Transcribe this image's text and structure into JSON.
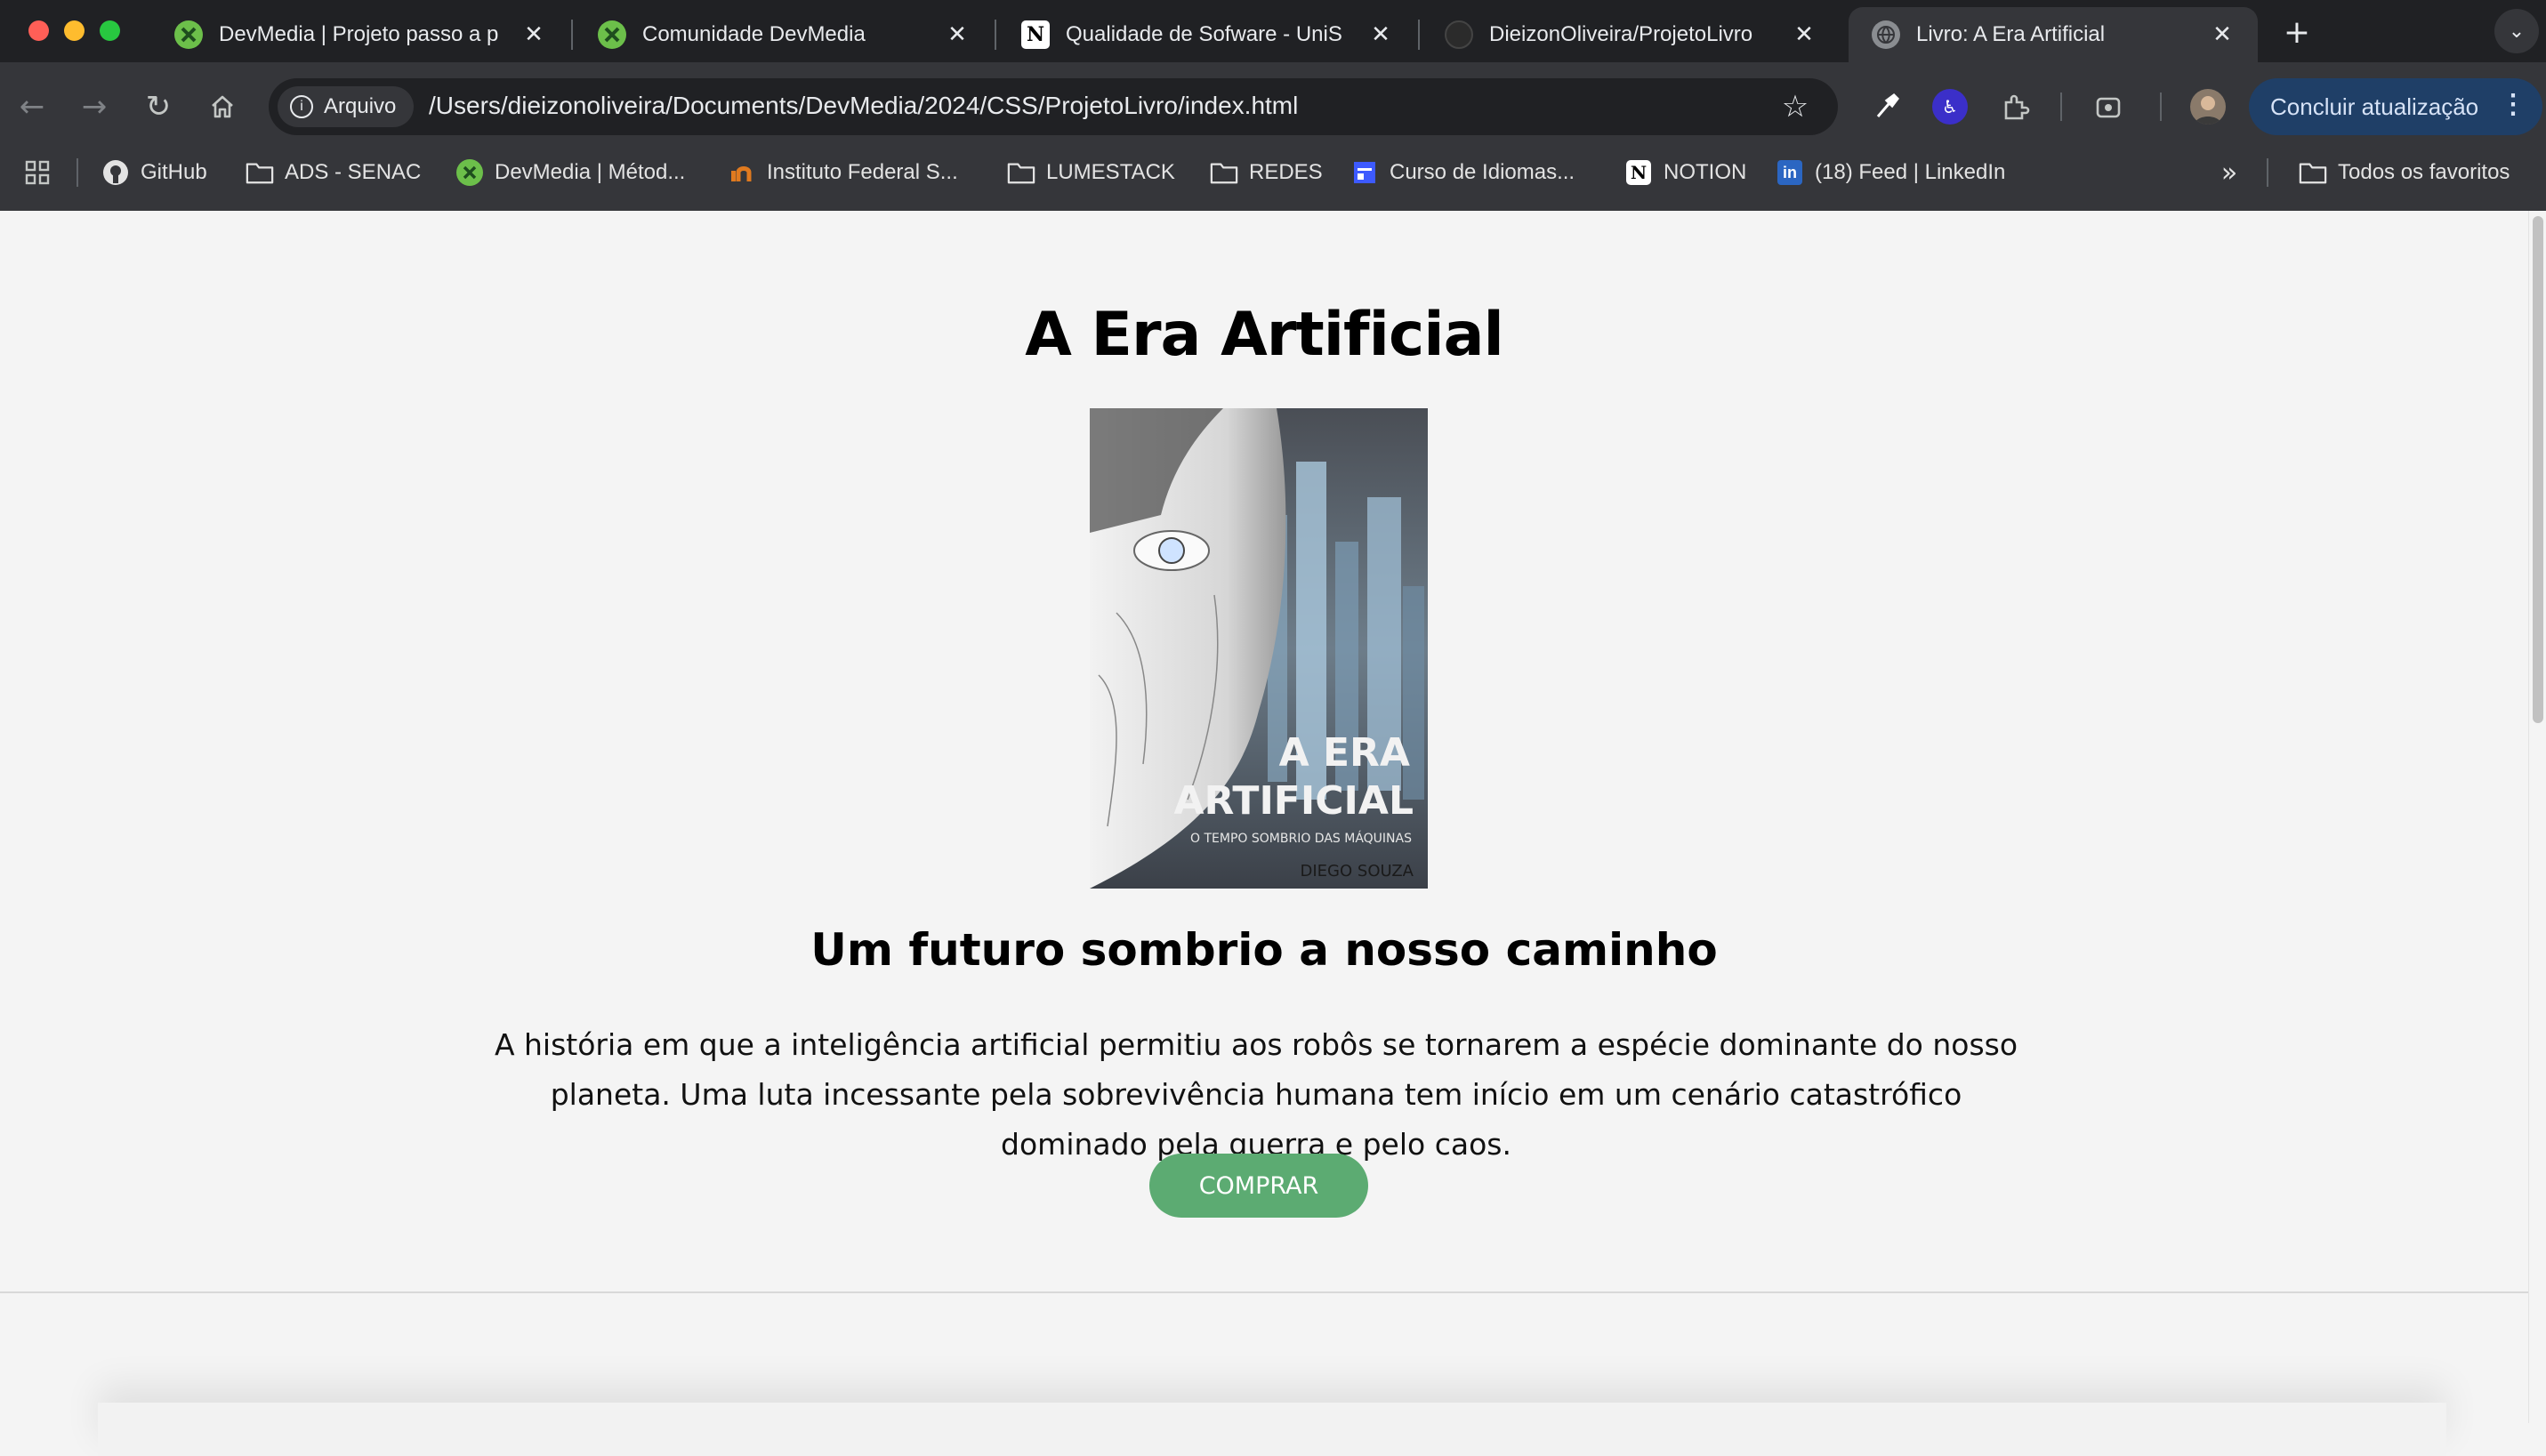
{
  "browser": {
    "tabs": [
      {
        "title": "DevMedia | Projeto passo a p",
        "favicon": "devmedia-icon",
        "active": false
      },
      {
        "title": "Comunidade DevMedia",
        "favicon": "devmedia-icon",
        "active": false
      },
      {
        "title": "Qualidade de Sofware - UniS",
        "favicon": "notion-icon",
        "active": false
      },
      {
        "title": "DieizonOliveira/ProjetoLivro",
        "favicon": "github-icon",
        "active": false
      },
      {
        "title": "Livro: A Era Artificial",
        "favicon": "globe-icon",
        "active": true
      }
    ],
    "address": {
      "chip_label": "Arquivo",
      "url": "/Users/dieizonoliveira/Documents/DevMedia/2024/CSS/ProjetoLivro/index.html"
    },
    "update_button": "Concluir atualização",
    "bookmarks": [
      {
        "label": "GitHub",
        "icon": "github-icon"
      },
      {
        "label": "ADS - SENAC",
        "icon": "folder-icon"
      },
      {
        "label": "DevMedia | Métod...",
        "icon": "devmedia-icon"
      },
      {
        "label": "Instituto Federal S...",
        "icon": "if-icon"
      },
      {
        "label": "LUMESTACK",
        "icon": "folder-icon"
      },
      {
        "label": "REDES",
        "icon": "folder-icon"
      },
      {
        "label": "Curso de Idiomas...",
        "icon": "calendar-icon"
      },
      {
        "label": "NOTION",
        "icon": "notion-icon"
      },
      {
        "label": "(18) Feed | LinkedIn",
        "icon": "linkedin-icon"
      }
    ],
    "all_bookmarks": "Todos os favoritos",
    "colors": {
      "tabstrip": "#202124",
      "toolbar": "#35363a",
      "update": "#1f3f67"
    }
  },
  "page": {
    "title": "A Era Artificial",
    "cover": {
      "title_line1": "A ERA",
      "title_line2": "ARTIFICIAL",
      "subtitle": "O TEMPO SOMBRIO DAS MÁQUINAS",
      "author": "DIEGO SOUZA"
    },
    "subtitle": "Um futuro sombrio a nosso caminho",
    "description": "A história em que a inteligência artificial permitiu aos robôs se tornarem a espécie dominante do nosso planeta. Uma luta incessante pela sobrevivência humana tem início em um cenário catastrófico dominado pela guerra e pelo caos.",
    "buy_button": "COMPRAR",
    "colors": {
      "background": "#f4f4f4",
      "button": "#5cab72"
    }
  }
}
